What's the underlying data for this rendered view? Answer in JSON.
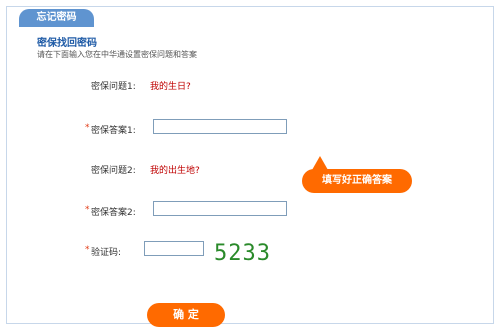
{
  "header": {
    "tab_label": "忘记密码"
  },
  "intro": {
    "title": "密保找回密码",
    "description": "请在下面输入您在中华通设置密保问题和答案"
  },
  "form": {
    "q1_label": "密保问题1:",
    "q1_value": "我的生日?",
    "a1_label": "密保答案1:",
    "q2_label": "密保问题2:",
    "q2_value": "我的出生地?",
    "a2_label": "密保答案2:",
    "captcha_label": "验证码:",
    "captcha_text": "5233",
    "required_mark": "*"
  },
  "tooltip": {
    "text": "填写好正确答案"
  },
  "actions": {
    "submit_label": "确 定"
  }
}
